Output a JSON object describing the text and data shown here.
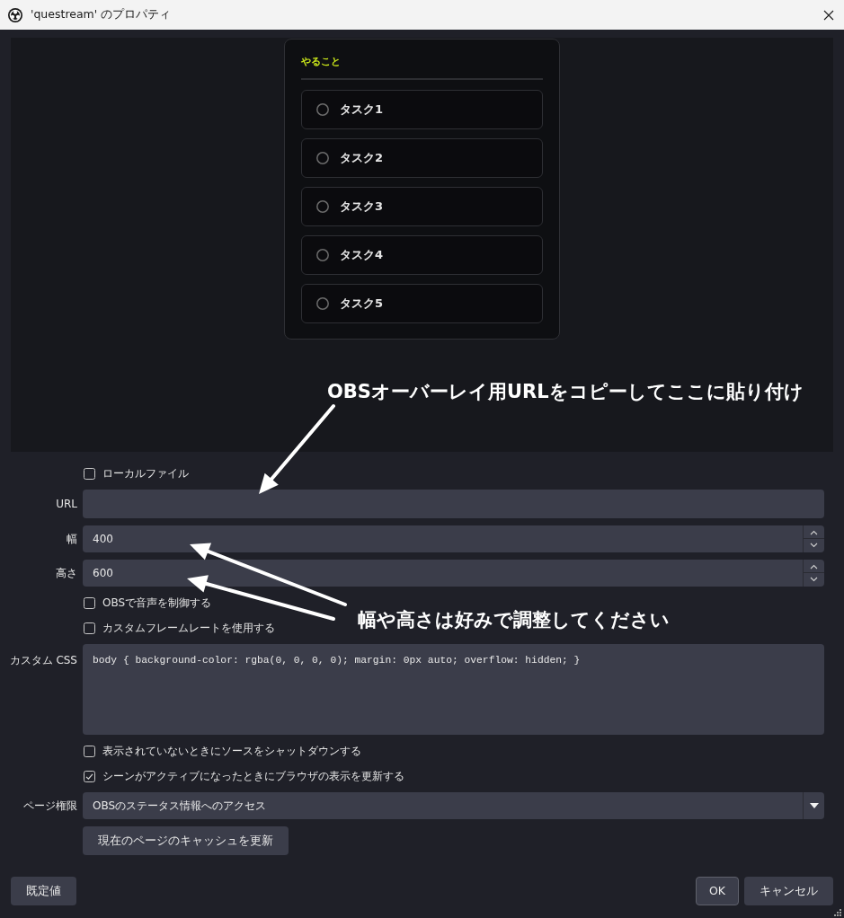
{
  "window": {
    "title": "'questream' のプロパティ"
  },
  "preview": {
    "title": "やること",
    "tasks": [
      {
        "label": "タスク1",
        "checked": false
      },
      {
        "label": "タスク2",
        "checked": false
      },
      {
        "label": "タスク3",
        "checked": false
      },
      {
        "label": "タスク4",
        "checked": false
      },
      {
        "label": "タスク5",
        "checked": false
      }
    ]
  },
  "annotations": [
    {
      "text": "OBSオーバーレイ用URLをコピーしてここに貼り付け"
    },
    {
      "text": "幅や高さは好みで調整してください"
    }
  ],
  "form": [
    {
      "kind": "checkbox",
      "label": "ローカルファイル",
      "checked": false
    },
    {
      "kind": "text",
      "label": "URL"
    },
    {
      "kind": "spin",
      "label": "幅",
      "value": "400"
    },
    {
      "kind": "spin",
      "label": "高さ",
      "value": "600"
    },
    {
      "kind": "checkbox",
      "label": "OBSで音声を制御する",
      "checked": false
    },
    {
      "kind": "checkbox",
      "label": "カスタムフレームレートを使用する",
      "checked": false
    },
    {
      "kind": "textarea",
      "label": "カスタム CSS",
      "value": "body { background-color: rgba(0, 0, 0, 0); margin: 0px auto; overflow: hidden; }"
    },
    {
      "kind": "checkbox",
      "label": "表示されていないときにソースをシャットダウンする",
      "checked": false
    },
    {
      "kind": "checkbox",
      "label": "シーンがアクティブになったときにブラウザの表示を更新する",
      "checked": true
    },
    {
      "kind": "select",
      "label": "ページ権限",
      "value": "OBSのステータス情報へのアクセス"
    },
    {
      "kind": "button",
      "label": "現在のページのキャッシュを更新"
    }
  ],
  "footer": {
    "left_buttons": [
      {
        "label": "既定値"
      }
    ],
    "right_buttons": [
      {
        "label": "OK",
        "default": true
      },
      {
        "label": "キャンセル",
        "default": false
      }
    ]
  }
}
